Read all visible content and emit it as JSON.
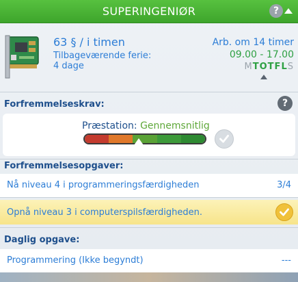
{
  "header": {
    "title": "SUPERINGENIØR",
    "help_label": "?"
  },
  "job": {
    "pay": "63 § / i timen",
    "vacation_label": "Tilbageværende ferie:",
    "vacation_value": "4 dage",
    "next_work": "Arb. om 14 timer",
    "work_hours": "09.00 - 17.00",
    "days": [
      {
        "letter": "M",
        "working": false
      },
      {
        "letter": "T",
        "working": true
      },
      {
        "letter": "O",
        "working": true
      },
      {
        "letter": "T",
        "working": true
      },
      {
        "letter": "F",
        "working": true
      },
      {
        "letter": "L",
        "working": true
      },
      {
        "letter": "S",
        "working": false
      }
    ]
  },
  "promotion": {
    "title": "Forfremmelseskrav:",
    "help_label": "?",
    "performance_label": "Præstation:",
    "performance_value": "Gennemsnitlig",
    "performance_level": 0.45,
    "meter_colors": [
      "#c43b2e",
      "#e0782a",
      "#5aa236",
      "#3d9a3a",
      "#2e8a32"
    ],
    "met": false
  },
  "tasks": {
    "title": "Forfremmelsesopgaver:",
    "items": [
      {
        "text": "Nå niveau 4 i programmeringsfærdigheden",
        "progress": "3/4",
        "done": false
      },
      {
        "text": "Opnå niveau 3 i computerspilsfærdigheden.",
        "progress": "",
        "done": true
      }
    ]
  },
  "daily": {
    "title": "Daglig opgave:",
    "text": "Programmering (Ikke begyndt)",
    "progress": "---"
  },
  "colors": {
    "header_green": "#4fb83a",
    "text_blue": "#2c7dd6",
    "heading_navy": "#1e4f8c",
    "positive_green": "#2ea043",
    "done_gold": "#f0c13a"
  }
}
